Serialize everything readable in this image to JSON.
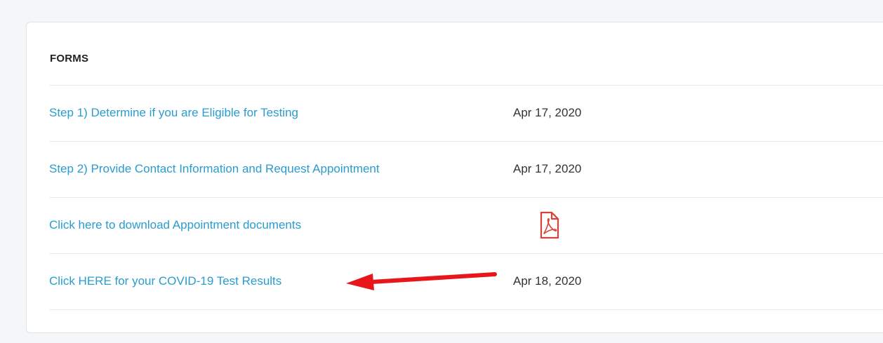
{
  "forms": {
    "title": "FORMS",
    "rows": [
      {
        "label": "Step 1) Determine if you are Eligible for Testing",
        "date": "Apr 17, 2020"
      },
      {
        "label": "Step 2) Provide Contact Information and Request Appointment",
        "date": "Apr 17, 2020"
      },
      {
        "label": "Click here to download Appointment documents",
        "icon": "pdf-icon"
      },
      {
        "label": "Click HERE for your COVID-19 Test Results",
        "date": "Apr 18, 2020"
      }
    ]
  },
  "annotation": {
    "icon": "red-arrow-icon",
    "color": "#e8161b"
  },
  "colors": {
    "link": "#2a9ccd",
    "pdf": "#d9423a"
  }
}
